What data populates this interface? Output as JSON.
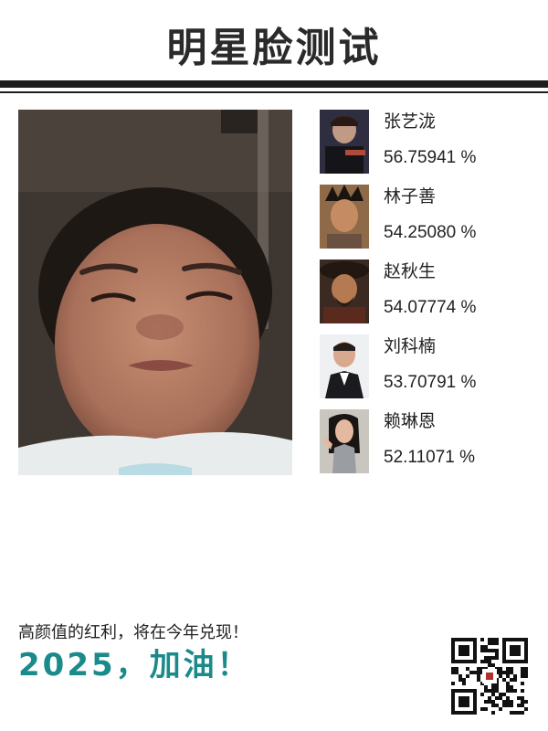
{
  "title": "明星脸测试",
  "photo": {
    "icon": "user-face-photo"
  },
  "matches": [
    {
      "name": "张艺泷",
      "score": "56.75941 %"
    },
    {
      "name": "林子善",
      "score": "54.25080 %"
    },
    {
      "name": "赵秋生",
      "score": "54.07774 %"
    },
    {
      "name": "刘科楠",
      "score": "53.70791 %"
    },
    {
      "name": "赖琳恩",
      "score": "52.11071 %"
    }
  ],
  "footer": {
    "tagline": "高颜值的红利，将在今年兑现！",
    "slogan": "2025，加油！",
    "qr_icon": "qr-code-icon"
  },
  "colors": {
    "title": "#2a2a2a",
    "rule": "#1e1e1e",
    "slogan": "#1b8a8a"
  }
}
